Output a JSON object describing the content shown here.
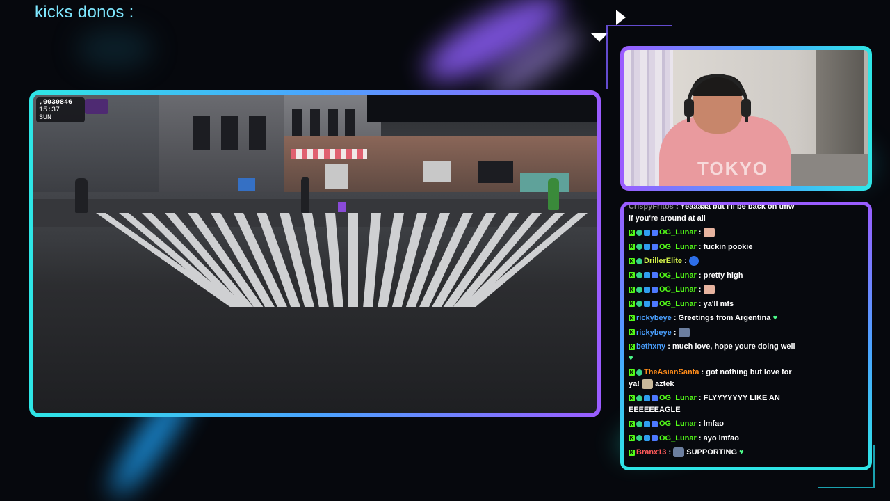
{
  "overlay": {
    "donos_title": "kicks donos :"
  },
  "game_hud": {
    "cash": ",0030846",
    "time": "15:37",
    "day": "SUN"
  },
  "webcam": {
    "shirt_text": "TOKYO"
  },
  "chat": {
    "messages": [
      {
        "user": "CrispyFritos",
        "color": "gray",
        "badges": [],
        "text": "Yeaaaaa but I'll be back on tmw if you're around at all"
      },
      {
        "user": "OG_Lunar",
        "color": "green",
        "badges": [
          "kick",
          "verified",
          "boost",
          "gift"
        ],
        "text": "",
        "emote": "face"
      },
      {
        "user": "OG_Lunar",
        "color": "green",
        "badges": [
          "kick",
          "verified",
          "boost",
          "gift"
        ],
        "text": "fuckin pookie"
      },
      {
        "user": "DrillerElite",
        "color": "yellow",
        "badges": [
          "kick",
          "verified"
        ],
        "text": "",
        "emote": "blob"
      },
      {
        "user": "OG_Lunar",
        "color": "green",
        "badges": [
          "kick",
          "verified",
          "boost",
          "gift"
        ],
        "text": "pretty high"
      },
      {
        "user": "OG_Lunar",
        "color": "green",
        "badges": [
          "kick",
          "verified",
          "boost",
          "gift"
        ],
        "text": "",
        "emote": "face"
      },
      {
        "user": "OG_Lunar",
        "color": "green",
        "badges": [
          "kick",
          "verified",
          "boost",
          "gift"
        ],
        "text": "ya'll mfs"
      },
      {
        "user": "rickybeye",
        "color": "blue",
        "badges": [
          "kick"
        ],
        "text": "Greetings from Argentina",
        "emote_after": "heart"
      },
      {
        "user": "rickybeye",
        "color": "blue",
        "badges": [
          "kick"
        ],
        "text": "",
        "emote": "gif"
      },
      {
        "user": "bethxny",
        "color": "blue",
        "badges": [
          "kick"
        ],
        "text": "much love, hope youre doing well",
        "emote_after": "heart"
      },
      {
        "user": "TheAsianSanta",
        "color": "orange",
        "badges": [
          "kick",
          "verified"
        ],
        "text": "got nothing but love for ya!",
        "emote_after": "dog",
        "text_after": "aztek"
      },
      {
        "user": "OG_Lunar",
        "color": "green",
        "badges": [
          "kick",
          "verified",
          "boost",
          "gift"
        ],
        "text": "FLYYYYYYY LIKE AN EEEEEEAGLE"
      },
      {
        "user": "OG_Lunar",
        "color": "green",
        "badges": [
          "kick",
          "verified",
          "boost",
          "gift"
        ],
        "text": "lmfao"
      },
      {
        "user": "OG_Lunar",
        "color": "green",
        "badges": [
          "kick",
          "verified",
          "boost",
          "gift"
        ],
        "text": "ayo lmfao"
      },
      {
        "user": "Branx13",
        "color": "red",
        "badges": [
          "kick"
        ],
        "text": "SUPPORTING",
        "emote_before": "gif",
        "emote_after": "heart"
      }
    ]
  },
  "colors": {
    "kick_green": "#53fc18",
    "frame_cyan": "#2ee6e6",
    "frame_purple": "#9b5cff"
  }
}
